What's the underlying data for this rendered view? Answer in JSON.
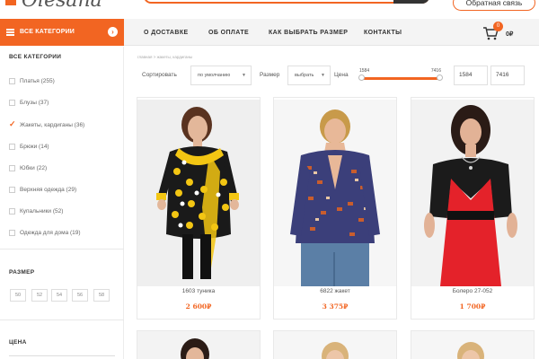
{
  "header": {
    "logo_text": "Olesana",
    "callback_label": "Обратная связь"
  },
  "nav": {
    "categories_button": "ВСЕ КАТЕГОРИИ",
    "links": [
      "О ДОСТАВКЕ",
      "ОБ ОПЛАТЕ",
      "КАК ВЫБРАТЬ РАЗМЕР",
      "КОНТАКТЫ"
    ],
    "cart_count": "0",
    "cart_total": "0₽"
  },
  "sidebar": {
    "categories_title": "ВСЕ КАТЕГОРИИ",
    "categories": [
      {
        "label": "Платья (255)",
        "checked": false
      },
      {
        "label": "Блузы (37)",
        "checked": false
      },
      {
        "label": "Жакеты, кардиганы (36)",
        "checked": true
      },
      {
        "label": "Брюки (14)",
        "checked": false
      },
      {
        "label": "Юбки (22)",
        "checked": false
      },
      {
        "label": "Верхняя одежда (29)",
        "checked": false
      },
      {
        "label": "Купальники (52)",
        "checked": false
      },
      {
        "label": "Одежда для дома (19)",
        "checked": false
      }
    ],
    "size_title": "РАЗМЕР",
    "sizes": [
      "50",
      "52",
      "54",
      "56",
      "58"
    ],
    "price_title": "ЦЕНА"
  },
  "filters": {
    "breadcrumb": "главная  >  жакеты, кардиганы",
    "sort_label": "Сортировать",
    "sort_value": "по умолчанию",
    "size_label": "Размер",
    "size_value": "выбрать",
    "price_label": "Цена",
    "price_min": "1584",
    "price_max": "7416",
    "range_min": "1584",
    "range_max": "7416"
  },
  "products": [
    {
      "name": "1603 туника",
      "price": "2 600₽"
    },
    {
      "name": "6822 жакет",
      "price": "3 375₽"
    },
    {
      "name": "Болеро 27-052",
      "price": "1 700₽"
    }
  ],
  "colors": {
    "accent": "#f26522",
    "text": "#333333"
  }
}
